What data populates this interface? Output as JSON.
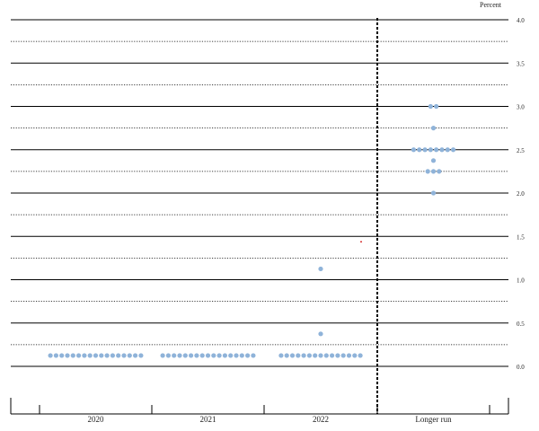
{
  "chart_data": {
    "type": "scatter",
    "unit_label": "Percent",
    "categories": [
      "2020",
      "2021",
      "2022",
      "Longer run"
    ],
    "y_ticks": [
      "0.0",
      "0.5",
      "1.0",
      "1.5",
      "2.0",
      "2.5",
      "3.0",
      "3.5",
      "4.0"
    ],
    "ylim": [
      0.0,
      4.0
    ],
    "grid": true,
    "divider_after_category": "2022",
    "dot_color": "#8fb3d9",
    "marker_color": "#cc0000",
    "series": [
      {
        "category": "2020",
        "points": [
          {
            "y": 0.125,
            "count": 17
          }
        ]
      },
      {
        "category": "2021",
        "points": [
          {
            "y": 0.125,
            "count": 17
          }
        ]
      },
      {
        "category": "2022",
        "points": [
          {
            "y": 0.125,
            "count": 15
          },
          {
            "y": 0.375,
            "count": 1
          },
          {
            "y": 1.125,
            "count": 1
          }
        ]
      },
      {
        "category": "Longer run",
        "points": [
          {
            "y": 2.0,
            "count": 1
          },
          {
            "y": 2.25,
            "count": 3
          },
          {
            "y": 2.375,
            "count": 1
          },
          {
            "y": 2.5,
            "count": 8
          },
          {
            "y": 2.75,
            "count": 1
          },
          {
            "y": 3.0,
            "count": 2
          }
        ]
      }
    ],
    "markers": [
      {
        "category": "2022",
        "y": 1.4375
      }
    ]
  }
}
